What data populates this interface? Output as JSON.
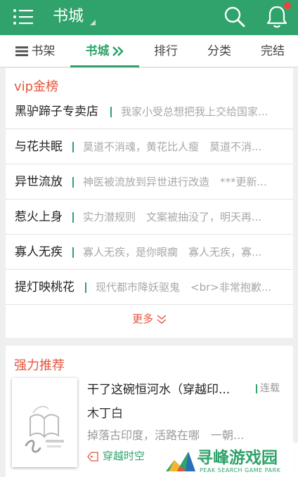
{
  "header": {
    "title": "书城",
    "menu_icon": "list-menu-icon",
    "search_icon": "search-icon",
    "bell_icon": "bell-icon",
    "notification_dot_color": "#f0413b",
    "accent_color": "#2fa36b"
  },
  "tabs": [
    {
      "label": "书架",
      "icon": "bookshelf-icon"
    },
    {
      "label": "书城",
      "active": true,
      "icon": "double-chevron-right-icon"
    },
    {
      "label": "排行"
    },
    {
      "label": "分类"
    },
    {
      "label": "完结"
    }
  ],
  "vip": {
    "title": "vip金榜",
    "items": [
      {
        "name": "黑驴蹄子专卖店",
        "desc": "我家小受总想把我上交给国家..."
      },
      {
        "name": "与花共眠",
        "desc": "莫道不消魂，黄花比人瘦　莫道不消..."
      },
      {
        "name": "异世流放",
        "desc": "神医被流放到异世进行改造　***更新..."
      },
      {
        "name": "惹火上身",
        "desc": "实力潜规则　文案被抽没了，明天再..."
      },
      {
        "name": "寡人无疾",
        "desc": "寡人无疾，是你眼瘸　寡人无疾，寡..."
      },
      {
        "name": "提灯映桃花",
        "desc": "现代都市降妖驱鬼　<br>非常抱歉..."
      }
    ],
    "more_label": "更多"
  },
  "recommend": {
    "title": "强力推荐",
    "book": {
      "title": "干了这碗恒河水（穿越印...",
      "status": "连载",
      "author": "木丁白",
      "intro": "掉落古印度，活路在哪　一朝...",
      "tag": "穿越时空"
    }
  },
  "watermark": {
    "name": "寻峰游戏园",
    "sub": "PEAK SEARCH GAME PARK"
  }
}
